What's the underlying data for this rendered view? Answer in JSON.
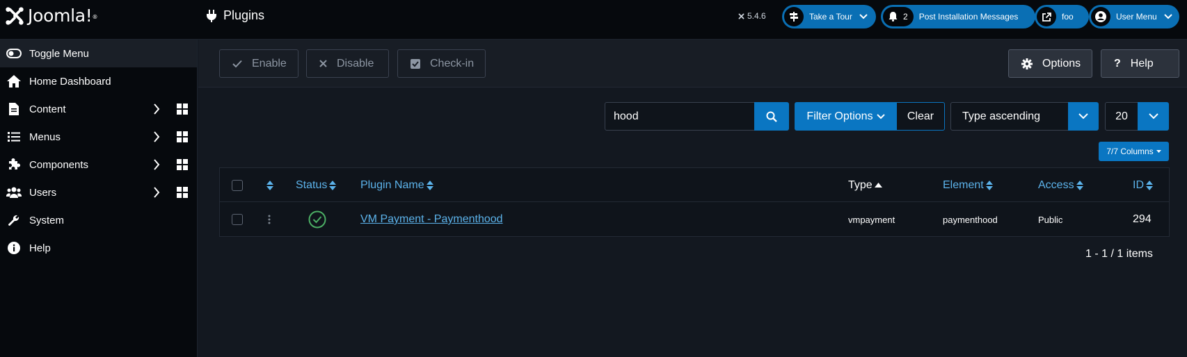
{
  "header": {
    "logo_text": "Joomla!",
    "logo_mark": "®",
    "page_title": "Plugins",
    "version": "5.4.6",
    "tour_label": "Take a Tour",
    "messages_count": "2",
    "messages_label": "Post Installation Messages",
    "site_label": "foo",
    "user_menu_label": "User Menu"
  },
  "sidebar": {
    "items": [
      {
        "label": "Toggle Menu",
        "icon": "toggle-icon"
      },
      {
        "label": "Home Dashboard",
        "icon": "home-icon"
      },
      {
        "label": "Content",
        "icon": "file-icon"
      },
      {
        "label": "Menus",
        "icon": "list-icon"
      },
      {
        "label": "Components",
        "icon": "puzzle-icon"
      },
      {
        "label": "Users",
        "icon": "users-icon"
      },
      {
        "label": "System",
        "icon": "wrench-icon"
      },
      {
        "label": "Help",
        "icon": "info-icon"
      }
    ]
  },
  "toolbar": {
    "enable_label": "Enable",
    "disable_label": "Disable",
    "checkin_label": "Check-in",
    "options_label": "Options",
    "help_label": "Help"
  },
  "filters": {
    "search_value": "hood",
    "filter_options_label": "Filter Options",
    "clear_label": "Clear",
    "sort_value": "Type ascending",
    "limit_value": "20",
    "columns_label": "7/7 Columns"
  },
  "table": {
    "headers": {
      "status": "Status",
      "plugin_name": "Plugin Name",
      "type": "Type",
      "element": "Element",
      "access": "Access",
      "id": "ID"
    },
    "rows": [
      {
        "name": "VM Payment - Paymenthood",
        "type": "vmpayment",
        "element": "paymenthood",
        "access": "Public",
        "id": "294",
        "status": "enabled"
      }
    ]
  },
  "pagination": {
    "summary": "1 - 1 / 1 items"
  },
  "colors": {
    "accent": "#0a76c2",
    "link": "#5cb3eb",
    "success": "#4caf65",
    "header_bg": "#06090d",
    "content_bg": "#131820"
  }
}
